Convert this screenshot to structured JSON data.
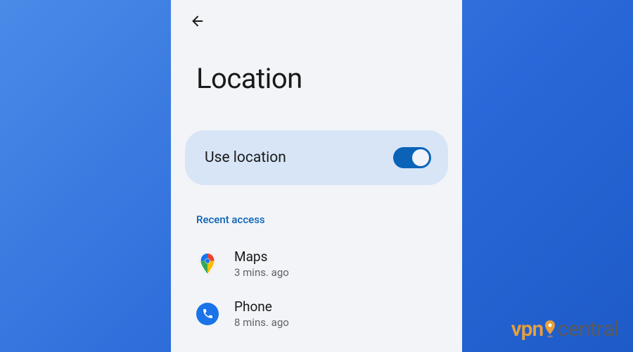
{
  "colors": {
    "accent": "#0b63b8",
    "background_gradient_start": "#4a8be8",
    "background_gradient_end": "#1e5bc9",
    "screen_bg": "#f2f4f7",
    "toggle_card_bg": "#d7e5f7"
  },
  "page": {
    "title": "Location"
  },
  "toggle": {
    "label": "Use location",
    "state": "on"
  },
  "section": {
    "header": "Recent access"
  },
  "apps": [
    {
      "icon": "maps-icon",
      "name": "Maps",
      "time": "3 mins. ago"
    },
    {
      "icon": "phone-icon",
      "name": "Phone",
      "time": "8 mins. ago"
    }
  ],
  "watermark": {
    "part1": "vpn",
    "part2": "central"
  }
}
